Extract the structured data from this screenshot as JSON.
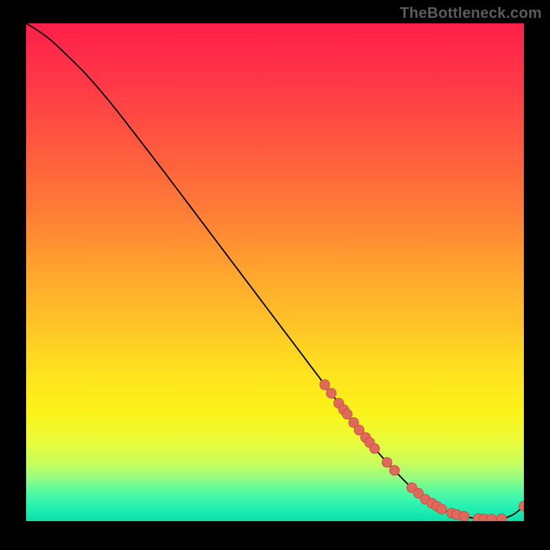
{
  "watermark": "TheBottleneck.com",
  "colors": {
    "background": "#000000",
    "watermark_text": "#5b5b5b",
    "curve_stroke": "#000000",
    "marker_fill": "#e0695b",
    "marker_stroke": "#c94f43",
    "gradient_stops": [
      {
        "offset": 0.0,
        "color": "#ff1f4a"
      },
      {
        "offset": 0.12,
        "color": "#ff3848"
      },
      {
        "offset": 0.25,
        "color": "#ff5a3f"
      },
      {
        "offset": 0.38,
        "color": "#ff7d36"
      },
      {
        "offset": 0.5,
        "color": "#ffa52e"
      },
      {
        "offset": 0.6,
        "color": "#ffc227"
      },
      {
        "offset": 0.7,
        "color": "#ffe21f"
      },
      {
        "offset": 0.78,
        "color": "#fbf319"
      },
      {
        "offset": 0.84,
        "color": "#e9fb38"
      },
      {
        "offset": 0.885,
        "color": "#c7fd5e"
      },
      {
        "offset": 0.915,
        "color": "#93fd82"
      },
      {
        "offset": 0.94,
        "color": "#56faa1"
      },
      {
        "offset": 0.965,
        "color": "#2ef2b0"
      },
      {
        "offset": 0.985,
        "color": "#17eab0"
      },
      {
        "offset": 1.0,
        "color": "#0be0a7"
      }
    ]
  },
  "chart_data": {
    "type": "line",
    "title": "",
    "xlabel": "",
    "ylabel": "",
    "xlim": [
      0,
      100
    ],
    "ylim": [
      0,
      100
    ],
    "grid": false,
    "series": [
      {
        "name": "curve",
        "x": [
          0.0,
          2.0,
          5.0,
          8.0,
          12.0,
          16.0,
          20.0,
          28.0,
          36.0,
          44.0,
          52.0,
          60.0,
          66.0,
          70.0,
          74.0,
          78.0,
          82.0,
          86.0,
          90.0,
          93.5,
          96.0,
          98.0,
          100.0
        ],
        "y": [
          100.0,
          98.8,
          96.6,
          93.8,
          89.8,
          85.2,
          80.2,
          69.8,
          59.2,
          48.6,
          38.0,
          27.4,
          19.4,
          14.6,
          10.2,
          6.2,
          3.2,
          1.4,
          0.6,
          0.4,
          0.6,
          1.4,
          3.0
        ]
      }
    ],
    "markers": {
      "name": "highlight-points",
      "x": [
        60.0,
        61.3,
        62.8,
        63.8,
        64.5,
        65.8,
        66.9,
        68.2,
        69.0,
        70.0,
        72.5,
        74.0,
        77.5,
        78.8,
        80.2,
        81.5,
        82.5,
        83.5,
        85.5,
        86.5,
        88.0,
        90.8,
        92.0,
        93.5,
        95.5,
        100.0
      ],
      "y": [
        27.4,
        25.7,
        23.7,
        22.4,
        21.5,
        19.8,
        18.3,
        16.8,
        15.8,
        14.6,
        11.8,
        10.2,
        6.7,
        5.6,
        4.4,
        3.6,
        3.0,
        2.4,
        1.6,
        1.3,
        0.95,
        0.5,
        0.42,
        0.4,
        0.48,
        3.0
      ]
    }
  }
}
